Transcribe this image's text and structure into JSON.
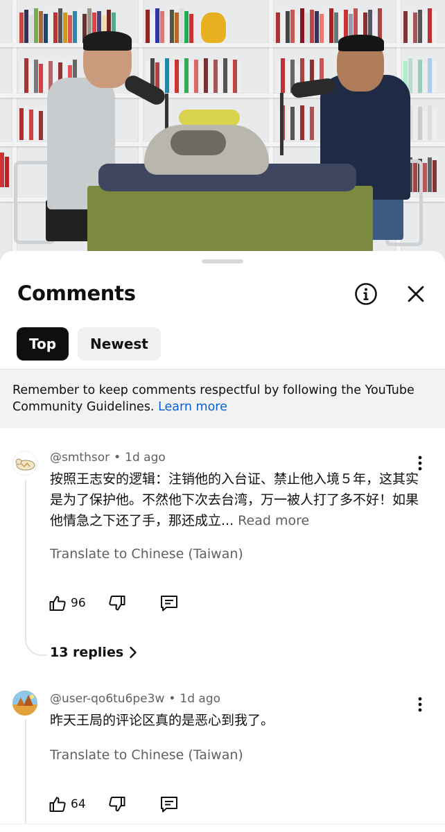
{
  "sheet": {
    "title": "Comments",
    "info_icon": "info-icon",
    "close_icon": "close-icon"
  },
  "sort": {
    "top_label": "Top",
    "newest_label": "Newest",
    "selected": "Top"
  },
  "notice": {
    "text": "Remember to keep comments respectful by following the YouTube Community Guidelines.",
    "link": "Learn more"
  },
  "comments": [
    {
      "author": "@smthsor",
      "time": "1d ago",
      "text": "按照王志安的逻辑：注销他的入台证、禁止他入境５年，这其实是为了保护他。不然他下次去台湾，万一被人打了多不好！如果他情急之下还了手，那还成立...",
      "read_more": "Read more",
      "translate": "Translate to Chinese (Taiwan)",
      "likes": "96",
      "replies": "13 replies"
    },
    {
      "author": "@user-qo6tu6pe3w",
      "time": "1d ago",
      "text": "昨天王局的评论区真的是恶心到我了。",
      "translate": "Translate to Chinese (Taiwan)",
      "likes": "64"
    }
  ],
  "colors": {
    "accent_link": "#065fd4",
    "secondary_text": "#606060",
    "chip_active": "#0f0f0f"
  }
}
